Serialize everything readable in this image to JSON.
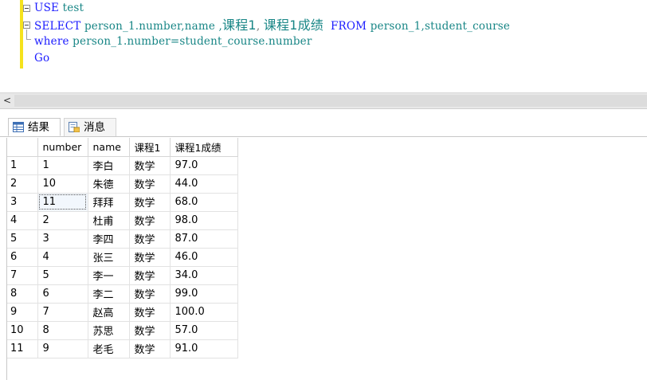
{
  "editor": {
    "line1": {
      "kw": "USE",
      "rest": " test"
    },
    "line2": {
      "kw_select": "SELECT",
      "cols": " person_1.number,name ,",
      "c1": "课程1",
      "sep": ", ",
      "c2": "课程1成绩",
      "gap": "  ",
      "kw_from": "FROM",
      "tables": " person_1,student_course"
    },
    "line3": {
      "kw": "where",
      "rest": " person_1.number=student_course.number"
    },
    "line4": {
      "kw": "Go"
    }
  },
  "scrollbar": {
    "left_arrow": "<"
  },
  "tabs": [
    {
      "label": "结果",
      "icon": "grid-icon",
      "active": true
    },
    {
      "label": "消息",
      "icon": "message-icon",
      "active": false
    }
  ],
  "grid": {
    "columns": [
      "number",
      "name",
      "课程1",
      "课程1成绩"
    ],
    "rows": [
      {
        "n": "1",
        "number": "1",
        "name": "李白",
        "c1": "数学",
        "score": "97.0"
      },
      {
        "n": "2",
        "number": "10",
        "name": "朱德",
        "c1": "数学",
        "score": "44.0"
      },
      {
        "n": "3",
        "number": "11",
        "name": "拜拜",
        "c1": "数学",
        "score": "68.0"
      },
      {
        "n": "4",
        "number": "2",
        "name": "杜甫",
        "c1": "数学",
        "score": "98.0"
      },
      {
        "n": "5",
        "number": "3",
        "name": "李四",
        "c1": "数学",
        "score": "87.0"
      },
      {
        "n": "6",
        "number": "4",
        "name": "张三",
        "c1": "数学",
        "score": "46.0"
      },
      {
        "n": "7",
        "number": "5",
        "name": "李一",
        "c1": "数学",
        "score": "34.0"
      },
      {
        "n": "8",
        "number": "6",
        "name": "李二",
        "c1": "数学",
        "score": "99.0"
      },
      {
        "n": "9",
        "number": "7",
        "name": "赵高",
        "c1": "数学",
        "score": "100.0"
      },
      {
        "n": "10",
        "number": "8",
        "name": "苏思",
        "c1": "数学",
        "score": "57.0"
      },
      {
        "n": "11",
        "number": "9",
        "name": "老毛",
        "c1": "数学",
        "score": "91.0"
      }
    ]
  },
  "colors": {
    "keyword": "#1a1aff",
    "text": "#188686",
    "change_bar": "#f5e21c"
  }
}
